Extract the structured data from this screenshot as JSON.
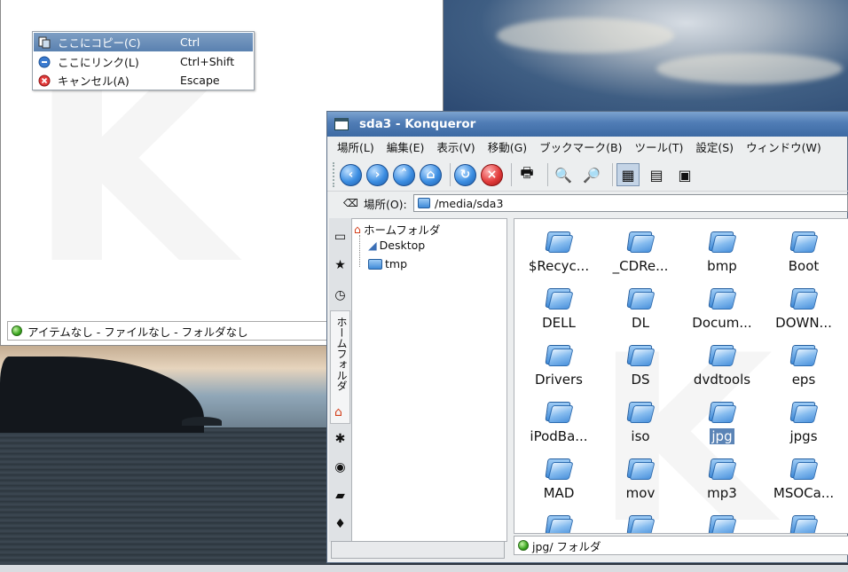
{
  "context_menu": {
    "items": [
      {
        "label": "ここにコピー(C)",
        "shortcut": "Ctrl",
        "icon": "copy-icon"
      },
      {
        "label": "ここにリンク(L)",
        "shortcut": "Ctrl+Shift",
        "icon": "link-icon"
      },
      {
        "label": "キャンセル(A)",
        "shortcut": "Escape",
        "icon": "cancel-icon"
      }
    ]
  },
  "back_window": {
    "status": "アイテムなし - ファイルなし - フォルダなし"
  },
  "konqueror": {
    "title": "sda3 - Konqueror",
    "menu": [
      "場所(L)",
      "編集(E)",
      "表示(V)",
      "移動(G)",
      "ブックマーク(B)",
      "ツール(T)",
      "設定(S)",
      "ウィンドウ(W)"
    ],
    "location_label": "場所(O):",
    "location_value": "/media/sda3",
    "sidebar_tab_label": "ホームフォルダ",
    "tree": {
      "root": "ホームフォルダ",
      "children": [
        "Desktop",
        "tmp"
      ]
    },
    "files": [
      "$Recyc...",
      "_CDRe...",
      "bmp",
      "Boot",
      "DELL",
      "DL",
      "Docum...",
      "DOWN...",
      "Drivers",
      "DS",
      "dvdtools",
      "eps",
      "iPodBa...",
      "iso",
      "jpg",
      "jpgs",
      "MAD",
      "mov",
      "mp3",
      "MSOCa..."
    ],
    "selected_file": "jpg",
    "status": "jpg/  フォルダ"
  }
}
